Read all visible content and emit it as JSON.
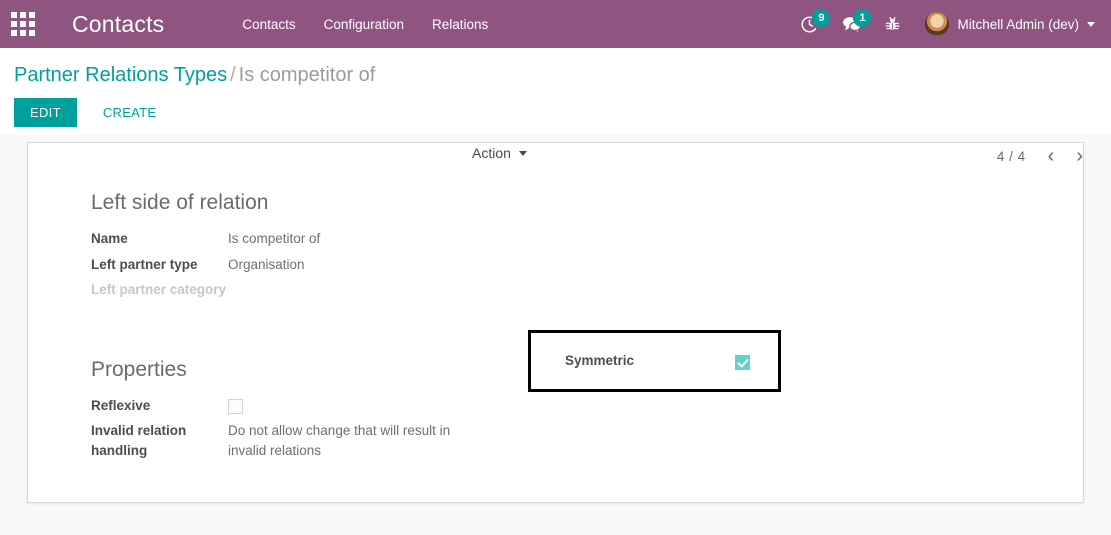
{
  "navbar": {
    "apps_icon": "apps-grid-icon",
    "brand": "Contacts",
    "menu": [
      {
        "label": "Contacts"
      },
      {
        "label": "Configuration"
      },
      {
        "label": "Relations"
      }
    ],
    "systray": {
      "activity_icon": "clock-activity-icon",
      "activity_count": "9",
      "messaging_icon": "messages-icon",
      "messaging_count": "1",
      "debug_icon": "bug-debug-icon",
      "avatar_icon": "user-avatar",
      "username": "Mitchell Admin (dev)"
    }
  },
  "control_panel": {
    "breadcrumb_root": "Partner Relations Types",
    "breadcrumb_separator": "/",
    "breadcrumb_current": "Is competitor of",
    "edit_label": "EDIT",
    "create_label": "CREATE",
    "action_label": "Action",
    "pager_value": "4 / 4",
    "pager_prev": "‹",
    "pager_next": "›"
  },
  "form": {
    "left_group": {
      "title": "Left side of relation",
      "fields": [
        {
          "label": "Name",
          "value": "Is competitor of"
        },
        {
          "label": "Left partner type",
          "value": "Organisation"
        },
        {
          "label": "Left partner category",
          "value": ""
        }
      ]
    },
    "properties_group": {
      "title": "Properties",
      "reflexive_label": "Reflexive",
      "reflexive_checked": false,
      "invalid_label": "Invalid relation handling",
      "invalid_value": "Do not allow change that will result in invalid relations",
      "symmetric_label": "Symmetric",
      "symmetric_checked": true
    }
  },
  "colors": {
    "navbar_purple": "#8f5480",
    "accent_teal": "#00a09d",
    "checkbox_teal": "#5fd3cc",
    "highlight_box": "#000000",
    "sheet_border": "#d8dadd",
    "page_background": "#f9f9f9"
  }
}
